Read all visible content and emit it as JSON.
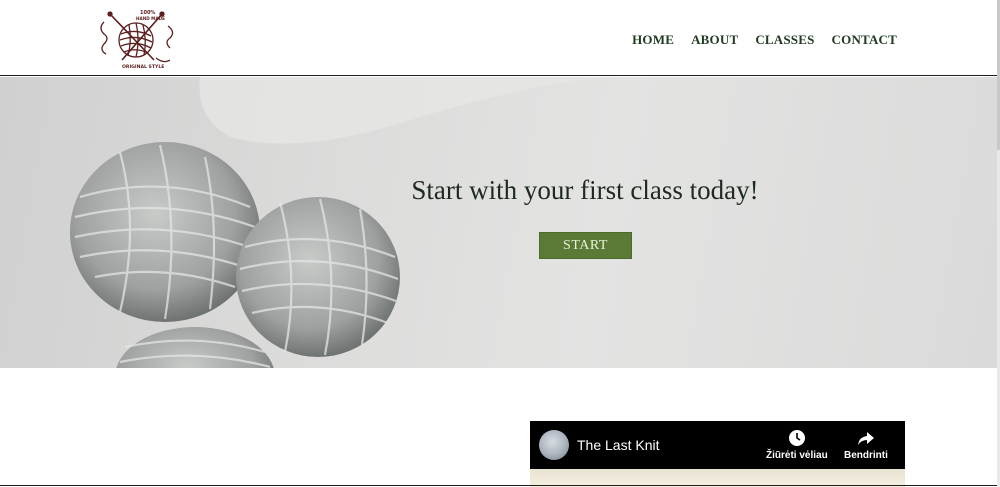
{
  "logo": {
    "top_text": "100%",
    "line2": "HAND MADE",
    "bottom_text": "ORIGINAL STYLE",
    "icon": "yarn-ball-logo"
  },
  "nav": {
    "items": [
      {
        "label": "HOME"
      },
      {
        "label": "ABOUT"
      },
      {
        "label": "CLASSES"
      },
      {
        "label": "CONTACT"
      }
    ]
  },
  "hero": {
    "title": "Start with your first class today!",
    "button_label": "START",
    "button_color": "#5a7a35"
  },
  "video": {
    "title": "The Last Knit",
    "watch_later_label": "Žiūrėti vėliau",
    "share_label": "Bendrinti",
    "watch_later_icon": "clock-icon",
    "share_icon": "share-arrow-icon"
  }
}
